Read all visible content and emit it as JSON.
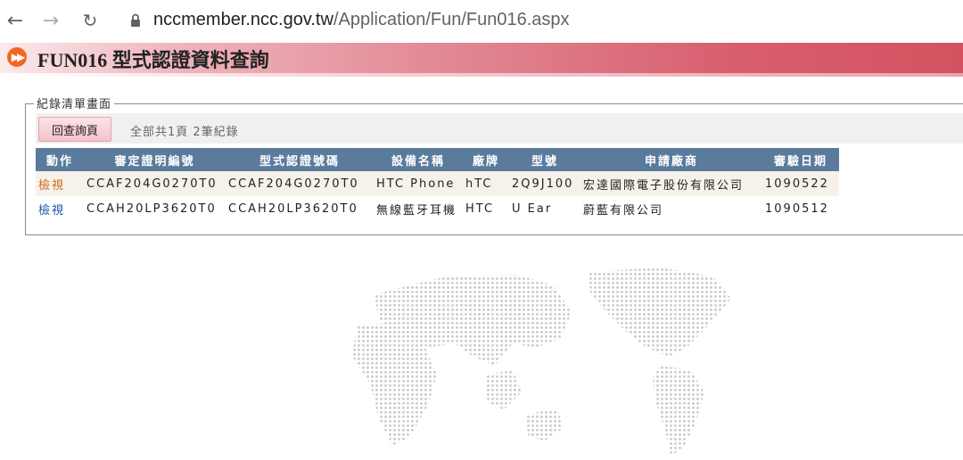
{
  "browser": {
    "url_domain": "nccmember.ncc.gov.tw",
    "url_path": "/Application/Fun/Fun016.aspx"
  },
  "header": {
    "title": "FUN016 型式認證資料查詢"
  },
  "records": {
    "legend": "紀錄清單畫面",
    "back_button": "回查詢頁",
    "summary": "全部共1頁 2筆紀錄",
    "columns": [
      "動作",
      "審定證明編號",
      "型式認證號碼",
      "設備名稱",
      "廠牌",
      "型號",
      "申請廠商",
      "審驗日期"
    ],
    "rows": [
      {
        "action": "檢視",
        "cert_no": "CCAF204G0270T0",
        "approval_no": "CCAF204G0270T0",
        "device": "HTC Phone",
        "brand": "hTC",
        "model": "2Q9J100",
        "applicant": "宏達國際電子股份有限公司",
        "date": "1090522"
      },
      {
        "action": "檢視",
        "cert_no": "CCAH20LP3620T0",
        "approval_no": "CCAH20LP3620T0",
        "device": "無線藍牙耳機",
        "brand": "HTC",
        "model": "U Ear",
        "applicant": "蔚藍有限公司",
        "date": "1090512"
      }
    ]
  },
  "colors": {
    "header_gradient_end": "#d4525f",
    "table_header": "#5b7b9c",
    "link_orange": "#d0691a",
    "link_blue": "#1a5aa6"
  }
}
